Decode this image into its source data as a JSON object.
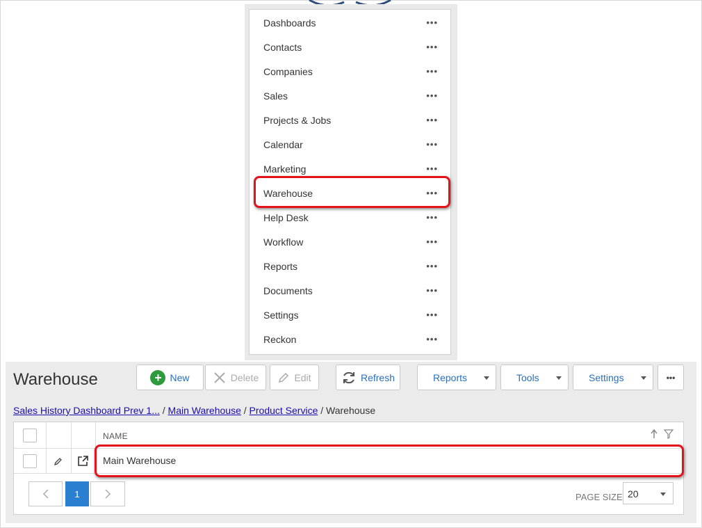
{
  "menu": {
    "items": [
      {
        "label": "Dashboards",
        "more": "•••"
      },
      {
        "label": "Contacts",
        "more": "•••"
      },
      {
        "label": "Companies",
        "more": "•••"
      },
      {
        "label": "Sales",
        "more": "•••"
      },
      {
        "label": "Projects & Jobs",
        "more": "•••"
      },
      {
        "label": "Calendar",
        "more": "•••"
      },
      {
        "label": "Marketing",
        "more": "•••"
      },
      {
        "label": "Warehouse",
        "more": "•••",
        "highlighted": true
      },
      {
        "label": "Help Desk",
        "more": "•••"
      },
      {
        "label": "Workflow",
        "more": "•••"
      },
      {
        "label": "Reports",
        "more": "•••"
      },
      {
        "label": "Documents",
        "more": "•••"
      },
      {
        "label": "Settings",
        "more": "•••"
      },
      {
        "label": "Reckon",
        "more": "•••"
      }
    ]
  },
  "page": {
    "title": "Warehouse"
  },
  "toolbar": {
    "new_label": "New",
    "delete_label": "Delete",
    "edit_label": "Edit",
    "refresh_label": "Refresh",
    "reports_label": "Reports",
    "tools_label": "Tools",
    "settings_label": "Settings",
    "more_label": "•••"
  },
  "breadcrumb": {
    "items": [
      "Sales History Dashboard Prev 1...",
      "Main Warehouse",
      "Product Service"
    ],
    "current": "Warehouse",
    "separator": "/"
  },
  "grid": {
    "columns": [
      "NAME"
    ],
    "rows": [
      {
        "name": "Main Warehouse",
        "highlighted": true
      }
    ]
  },
  "pager": {
    "current_page": "1",
    "page_size_label": "PAGE SIZE",
    "page_size": "20"
  },
  "colors": {
    "highlight": "#e3121b",
    "accent": "#2b7fd0",
    "new_icon": "#2d9a3e",
    "link": "#1a0dab"
  },
  "icons": [
    "plus-circle-icon",
    "close-icon",
    "pencil-icon",
    "refresh-icon",
    "chevron-left-icon",
    "chevron-right-icon",
    "external-link-icon",
    "sort-up-icon",
    "filter-icon",
    "caret-down-icon"
  ]
}
